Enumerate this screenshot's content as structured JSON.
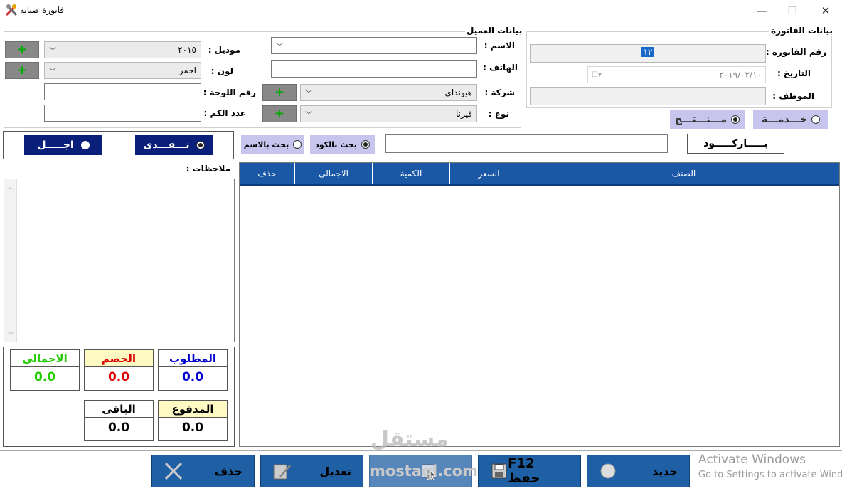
{
  "window": {
    "title": "فاتورة صيانة",
    "minimize": "—",
    "maximize": "☐",
    "close": "✕"
  },
  "invoice": {
    "group_title": "بيانات الفاتورة",
    "number_label": "رقم الفاتورة :",
    "number_value": "١٢",
    "date_label": "التاريخ :",
    "date_value": "٢٠١٩/٠٢/١٠",
    "employee_label": "الموظف :",
    "employee_value": ""
  },
  "customer": {
    "group_title": "بيانات العميل",
    "name_label": "الاسم :",
    "name_value": "",
    "phone_label": "الهاتف :",
    "phone_value": "",
    "company_label": "شركة :",
    "company_value": "هيونداى",
    "type_label": "نوع :",
    "type_value": "فيرنا",
    "model_label": "موديل :",
    "model_value": "٢٠١٥",
    "color_label": "لون :",
    "color_value": "احمر",
    "plate_label": "رقم اللوحة :",
    "plate_value": "",
    "km_label": "عدد الكم :",
    "km_value": "",
    "add": "+"
  },
  "item_type": {
    "product": "مـــنـــتـــج",
    "service": "خـــدمـــة"
  },
  "payment": {
    "cash": "نـــقـــدى",
    "credit": "اجـــــل"
  },
  "search": {
    "by_code": "بحث بالكود",
    "by_name": "بحث بالاسم",
    "value": "",
    "barcode_button": "بـــــاركـــــود"
  },
  "notes": {
    "label": "ملاحظات :",
    "value": ""
  },
  "grid": {
    "columns": [
      "الصنف",
      "السعر",
      "الكمية",
      "الاجمالى",
      "حذف"
    ]
  },
  "totals": {
    "required_label": "المطلوب",
    "required_value": "0.0",
    "discount_label": "الخصم",
    "discount_value": "0.0",
    "total_label": "الاجمالى",
    "total_value": "0.0",
    "paid_label": "المدفوع",
    "paid_value": "0.0",
    "remaining_label": "الباقى",
    "remaining_value": "0.0"
  },
  "colors": {
    "required": "#0000cc",
    "discount": "#dd0000",
    "total": "#22cc00"
  },
  "buttons": {
    "new": "جديد",
    "save": "F12 حفظ",
    "edit": "تعديل",
    "delete": "حذف"
  },
  "overlay": {
    "watermark_ar": "مستقل",
    "watermark_en": "mostaql.com",
    "activate_title": "Activate Windows",
    "activate_sub": "Go to Settings to activate Windows."
  }
}
